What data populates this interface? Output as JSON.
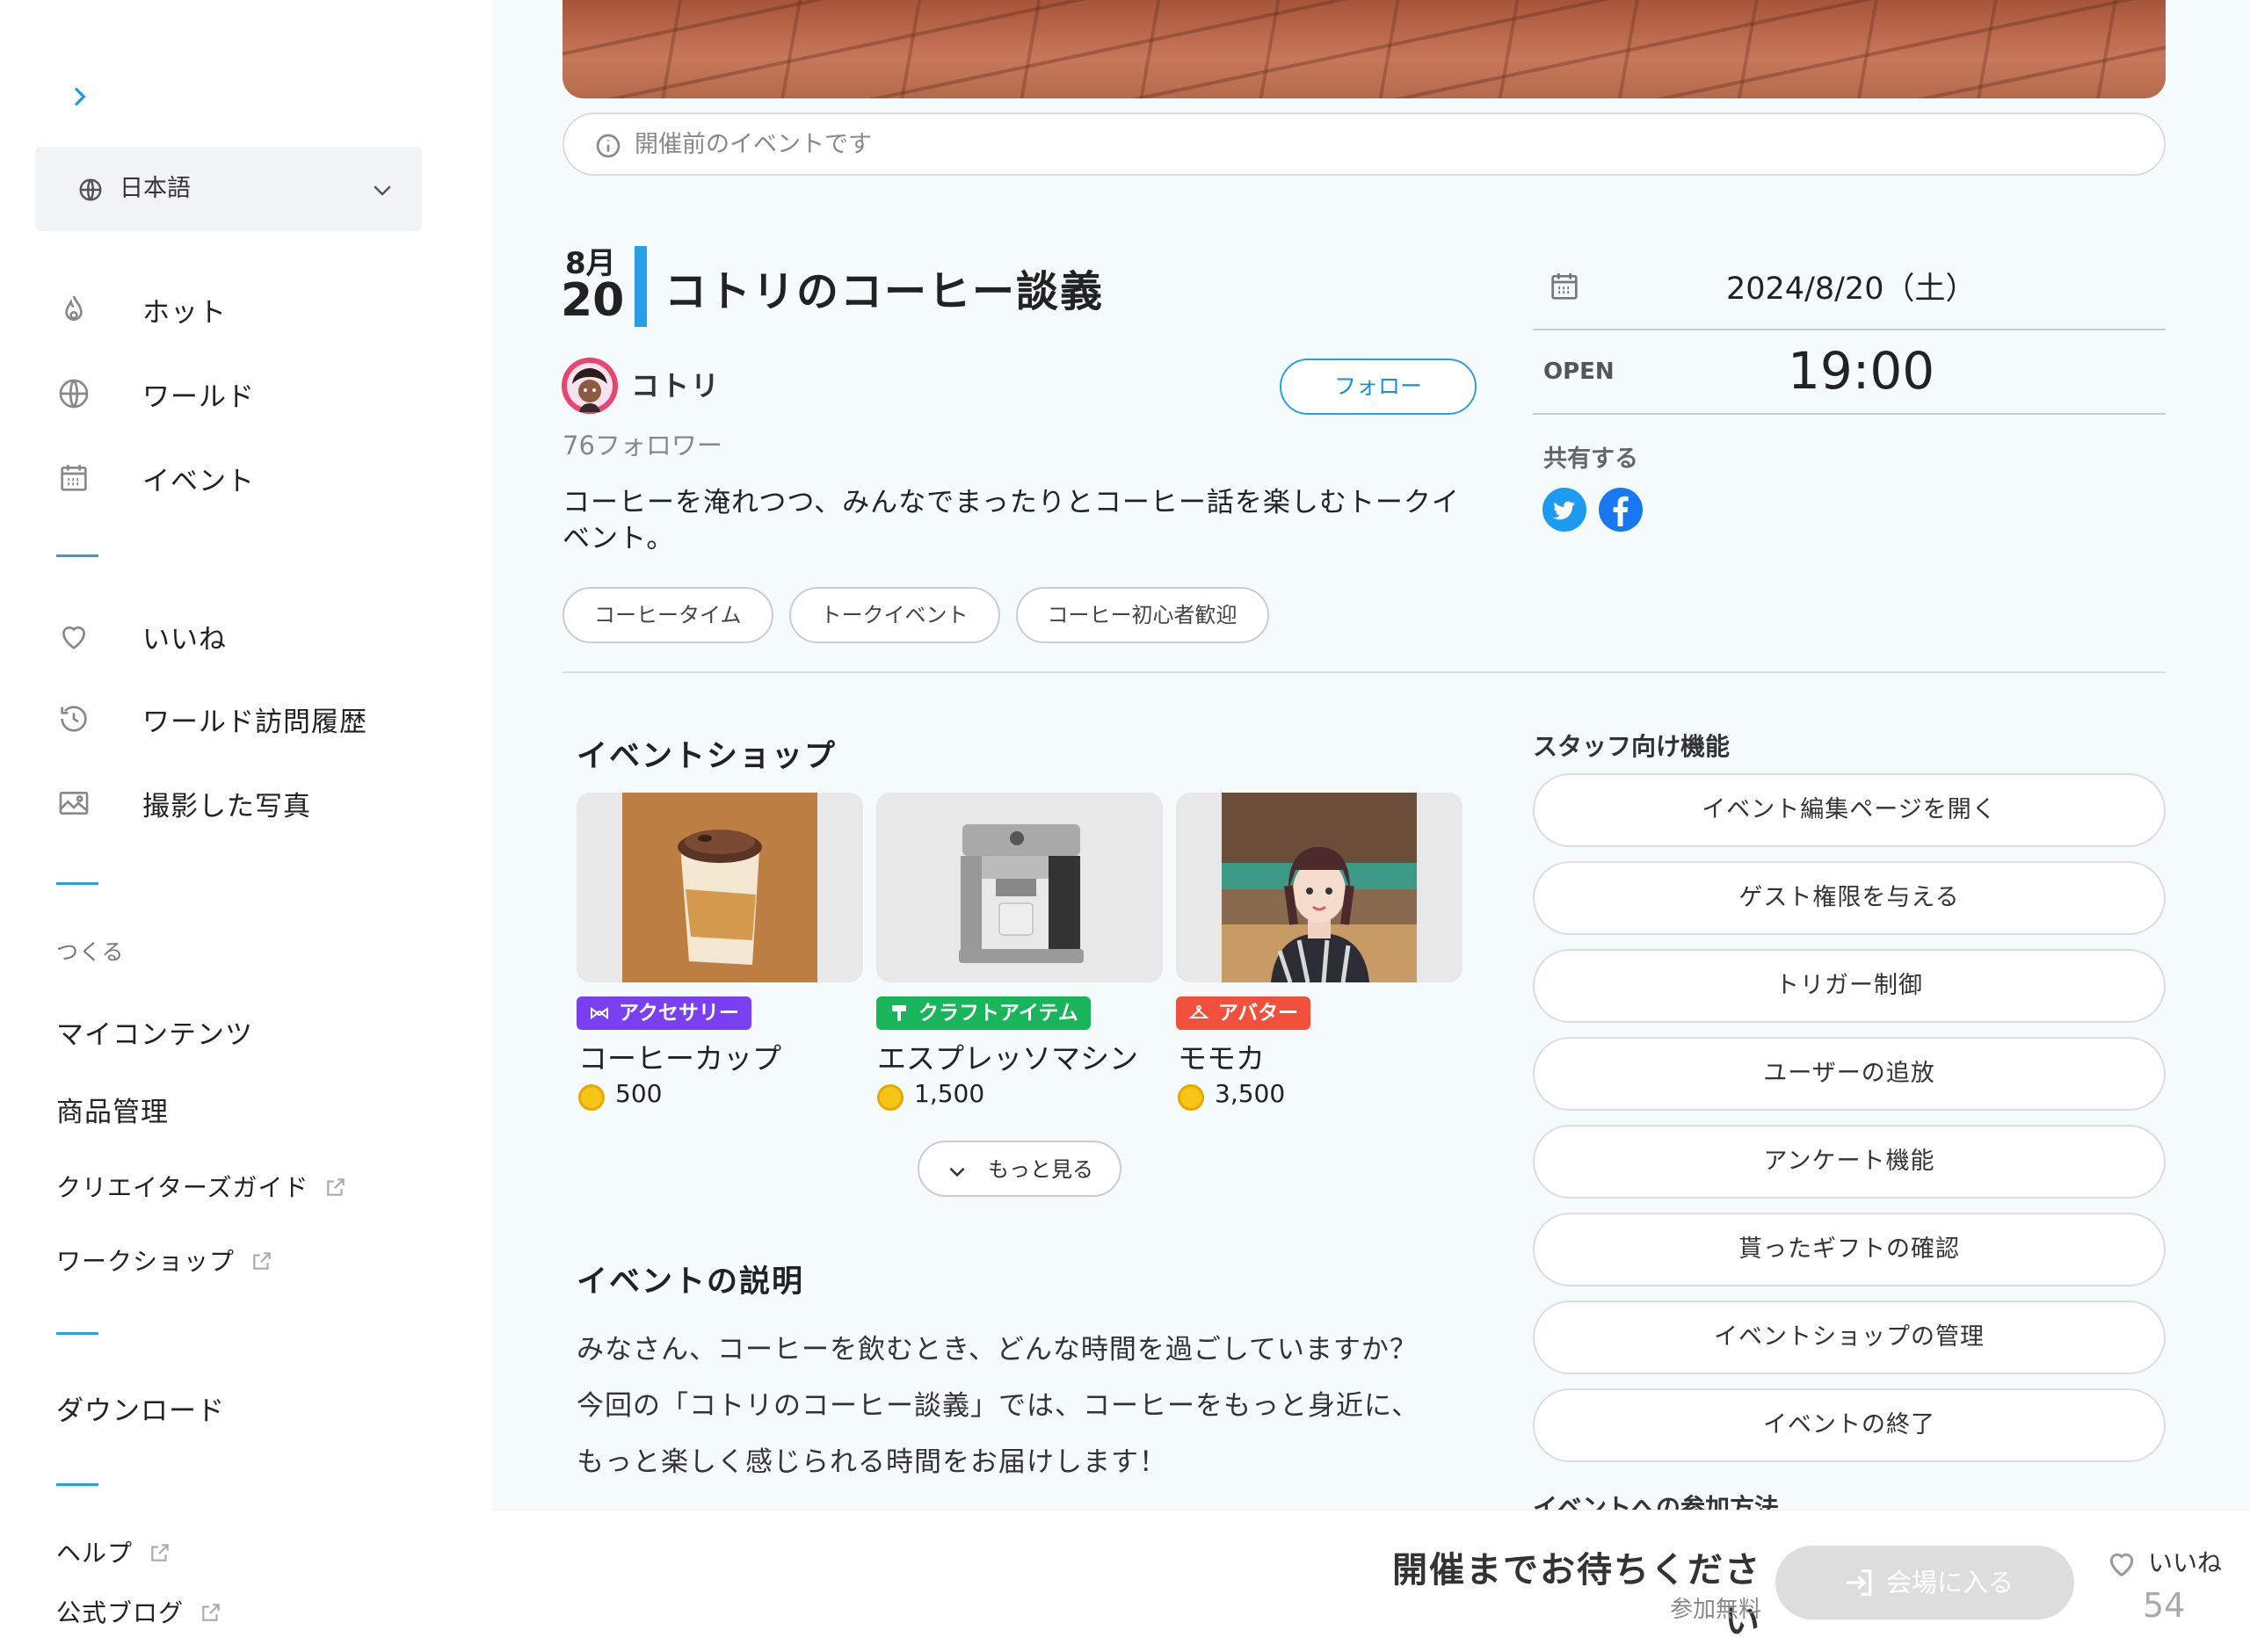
{
  "sidebar": {
    "language": "日本語",
    "nav_main": [
      "ホット",
      "ワールド",
      "イベント"
    ],
    "nav_personal": [
      "いいね",
      "ワールド訪問履歴",
      "撮影した写真"
    ],
    "create_section": "つくる",
    "create_items": [
      "マイコンテンツ",
      "商品管理"
    ],
    "external_links": [
      "クリエイターズガイド",
      "ワークショップ"
    ],
    "download": "ダウンロード",
    "help": "ヘルプ",
    "blog": "公式ブログ"
  },
  "event": {
    "status_notice": "開催前のイベントです",
    "month": "8月",
    "day": "20",
    "title": "コトリのコーヒー談義",
    "host_name": "コトリ",
    "followers": "76フォロワー",
    "follow_label": "フォロー",
    "description": "コーヒーを淹れつつ、みんなでまったりとコーヒー話を楽しむトークイベント。",
    "tags": [
      "コーヒータイム",
      "トークイベント",
      "コーヒー初心者歓迎"
    ],
    "date": "2024/8/20（土）",
    "open_label": "OPEN",
    "open_time": "19:00",
    "share_label": "共有する"
  },
  "shop": {
    "heading": "イベントショップ",
    "items": [
      {
        "category": "アクセサリー",
        "name": "コーヒーカップ",
        "price": "500",
        "badge_color": "#7b3ff2"
      },
      {
        "category": "クラフトアイテム",
        "name": "エスプレッソマシン",
        "price": "1,500",
        "badge_color": "#19b55a"
      },
      {
        "category": "アバター",
        "name": "モモカ",
        "price": "3,500",
        "badge_color": "#f0503c"
      }
    ],
    "more_label": "もっと見る"
  },
  "details": {
    "heading": "イベントの説明",
    "lines": [
      "みなさん、コーヒーを飲むとき、どんな時間を過ごしていますか？",
      "今回の「コトリのコーヒー談義」では、コーヒーをもっと身近に、",
      "もっと楽しく感じられる時間をお届けします！"
    ]
  },
  "staff": {
    "heading": "スタッフ向け機能",
    "buttons": [
      "イベント編集ページを開く",
      "ゲスト権限を与える",
      "トリガー制御",
      "ユーザーの追放",
      "アンケート機能",
      "貰ったギフトの確認",
      "イベントショップの管理",
      "イベントの終了"
    ],
    "join_heading": "イベントへの参加方法"
  },
  "footer": {
    "wait_message": "開催までお待ちください",
    "free_label": "参加無料",
    "enter_label": "会場に入る",
    "like_label": "いいね",
    "like_count": "54"
  },
  "colors": {
    "accent": "#29a0e6",
    "twitter": "#1d9bf0",
    "facebook": "#1877f2"
  }
}
